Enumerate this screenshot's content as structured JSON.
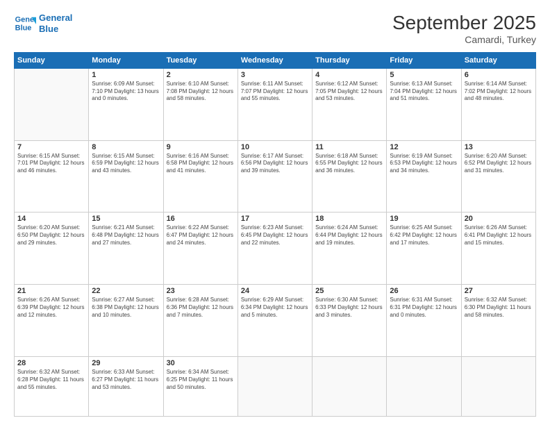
{
  "header": {
    "logo_line1": "General",
    "logo_line2": "Blue",
    "month": "September 2025",
    "location": "Camardi, Turkey"
  },
  "days_of_week": [
    "Sunday",
    "Monday",
    "Tuesday",
    "Wednesday",
    "Thursday",
    "Friday",
    "Saturday"
  ],
  "weeks": [
    [
      {
        "day": "",
        "info": ""
      },
      {
        "day": "1",
        "info": "Sunrise: 6:09 AM\nSunset: 7:10 PM\nDaylight: 13 hours\nand 0 minutes."
      },
      {
        "day": "2",
        "info": "Sunrise: 6:10 AM\nSunset: 7:08 PM\nDaylight: 12 hours\nand 58 minutes."
      },
      {
        "day": "3",
        "info": "Sunrise: 6:11 AM\nSunset: 7:07 PM\nDaylight: 12 hours\nand 55 minutes."
      },
      {
        "day": "4",
        "info": "Sunrise: 6:12 AM\nSunset: 7:05 PM\nDaylight: 12 hours\nand 53 minutes."
      },
      {
        "day": "5",
        "info": "Sunrise: 6:13 AM\nSunset: 7:04 PM\nDaylight: 12 hours\nand 51 minutes."
      },
      {
        "day": "6",
        "info": "Sunrise: 6:14 AM\nSunset: 7:02 PM\nDaylight: 12 hours\nand 48 minutes."
      }
    ],
    [
      {
        "day": "7",
        "info": "Sunrise: 6:15 AM\nSunset: 7:01 PM\nDaylight: 12 hours\nand 46 minutes."
      },
      {
        "day": "8",
        "info": "Sunrise: 6:15 AM\nSunset: 6:59 PM\nDaylight: 12 hours\nand 43 minutes."
      },
      {
        "day": "9",
        "info": "Sunrise: 6:16 AM\nSunset: 6:58 PM\nDaylight: 12 hours\nand 41 minutes."
      },
      {
        "day": "10",
        "info": "Sunrise: 6:17 AM\nSunset: 6:56 PM\nDaylight: 12 hours\nand 39 minutes."
      },
      {
        "day": "11",
        "info": "Sunrise: 6:18 AM\nSunset: 6:55 PM\nDaylight: 12 hours\nand 36 minutes."
      },
      {
        "day": "12",
        "info": "Sunrise: 6:19 AM\nSunset: 6:53 PM\nDaylight: 12 hours\nand 34 minutes."
      },
      {
        "day": "13",
        "info": "Sunrise: 6:20 AM\nSunset: 6:52 PM\nDaylight: 12 hours\nand 31 minutes."
      }
    ],
    [
      {
        "day": "14",
        "info": "Sunrise: 6:20 AM\nSunset: 6:50 PM\nDaylight: 12 hours\nand 29 minutes."
      },
      {
        "day": "15",
        "info": "Sunrise: 6:21 AM\nSunset: 6:48 PM\nDaylight: 12 hours\nand 27 minutes."
      },
      {
        "day": "16",
        "info": "Sunrise: 6:22 AM\nSunset: 6:47 PM\nDaylight: 12 hours\nand 24 minutes."
      },
      {
        "day": "17",
        "info": "Sunrise: 6:23 AM\nSunset: 6:45 PM\nDaylight: 12 hours\nand 22 minutes."
      },
      {
        "day": "18",
        "info": "Sunrise: 6:24 AM\nSunset: 6:44 PM\nDaylight: 12 hours\nand 19 minutes."
      },
      {
        "day": "19",
        "info": "Sunrise: 6:25 AM\nSunset: 6:42 PM\nDaylight: 12 hours\nand 17 minutes."
      },
      {
        "day": "20",
        "info": "Sunrise: 6:26 AM\nSunset: 6:41 PM\nDaylight: 12 hours\nand 15 minutes."
      }
    ],
    [
      {
        "day": "21",
        "info": "Sunrise: 6:26 AM\nSunset: 6:39 PM\nDaylight: 12 hours\nand 12 minutes."
      },
      {
        "day": "22",
        "info": "Sunrise: 6:27 AM\nSunset: 6:38 PM\nDaylight: 12 hours\nand 10 minutes."
      },
      {
        "day": "23",
        "info": "Sunrise: 6:28 AM\nSunset: 6:36 PM\nDaylight: 12 hours\nand 7 minutes."
      },
      {
        "day": "24",
        "info": "Sunrise: 6:29 AM\nSunset: 6:34 PM\nDaylight: 12 hours\nand 5 minutes."
      },
      {
        "day": "25",
        "info": "Sunrise: 6:30 AM\nSunset: 6:33 PM\nDaylight: 12 hours\nand 3 minutes."
      },
      {
        "day": "26",
        "info": "Sunrise: 6:31 AM\nSunset: 6:31 PM\nDaylight: 12 hours\nand 0 minutes."
      },
      {
        "day": "27",
        "info": "Sunrise: 6:32 AM\nSunset: 6:30 PM\nDaylight: 11 hours\nand 58 minutes."
      }
    ],
    [
      {
        "day": "28",
        "info": "Sunrise: 6:32 AM\nSunset: 6:28 PM\nDaylight: 11 hours\nand 55 minutes."
      },
      {
        "day": "29",
        "info": "Sunrise: 6:33 AM\nSunset: 6:27 PM\nDaylight: 11 hours\nand 53 minutes."
      },
      {
        "day": "30",
        "info": "Sunrise: 6:34 AM\nSunset: 6:25 PM\nDaylight: 11 hours\nand 50 minutes."
      },
      {
        "day": "",
        "info": ""
      },
      {
        "day": "",
        "info": ""
      },
      {
        "day": "",
        "info": ""
      },
      {
        "day": "",
        "info": ""
      }
    ]
  ]
}
